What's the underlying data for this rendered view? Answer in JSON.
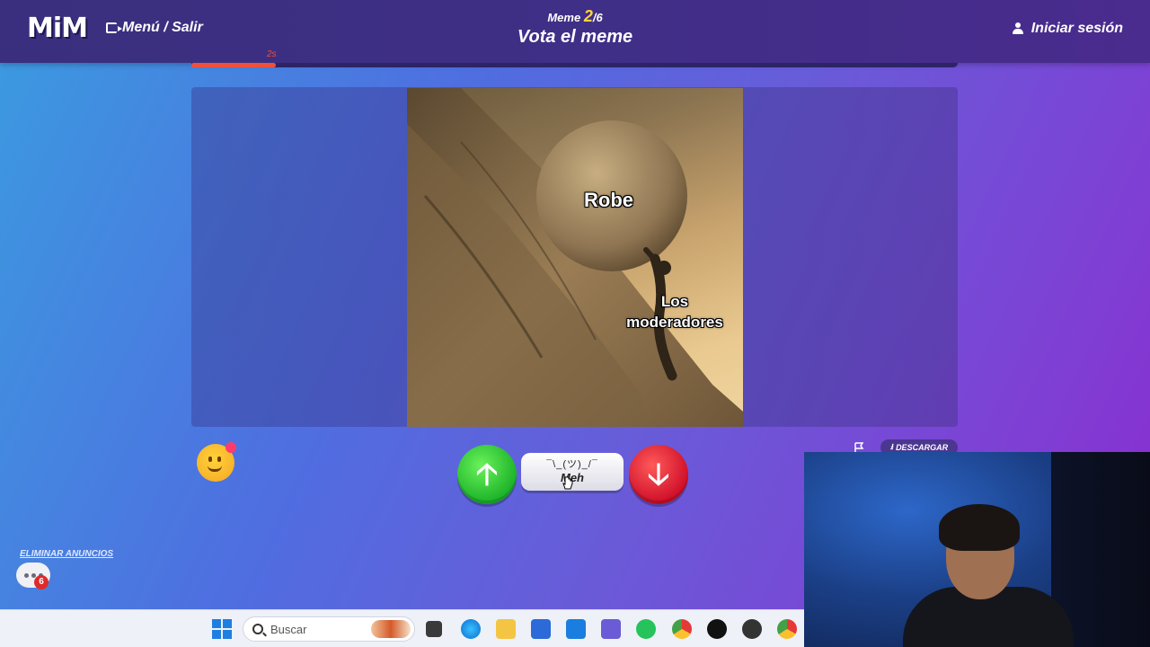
{
  "app": {
    "logo": "MiM",
    "menu_label": "Menú / Salir",
    "meme_label": "Meme",
    "meme_current": "2",
    "meme_total": "/6",
    "vote_title": "Vota el meme",
    "login_label": "Iniciar sesión",
    "timer_label": "2s",
    "timer_progress": 0.11
  },
  "meme": {
    "caption_top": "Robe",
    "caption_bottom_line1": "Los",
    "caption_bottom_line2": "moderadores"
  },
  "vote": {
    "up_arrow": "🡡",
    "down_arrow": "🡣",
    "meh_face": "¯\\_(ツ)_/¯",
    "meh_label": "Meh"
  },
  "actions": {
    "download_label": "DESCARGAR",
    "remove_ads_label": "ELIMINAR ANUNCIOS",
    "chat_badge": "6"
  },
  "taskbar": {
    "search_placeholder": "Buscar",
    "apps": [
      "windows-start",
      "file-explorer",
      "edge",
      "folder",
      "store",
      "outlook",
      "teams",
      "whatsapp",
      "chrome",
      "upwork",
      "obs",
      "chrome-2"
    ]
  },
  "colors": {
    "accent_yellow": "#ffd43b",
    "timer_red": "#f0503a",
    "vote_up_green": "#1db32a",
    "vote_down_red": "#d0102a"
  }
}
